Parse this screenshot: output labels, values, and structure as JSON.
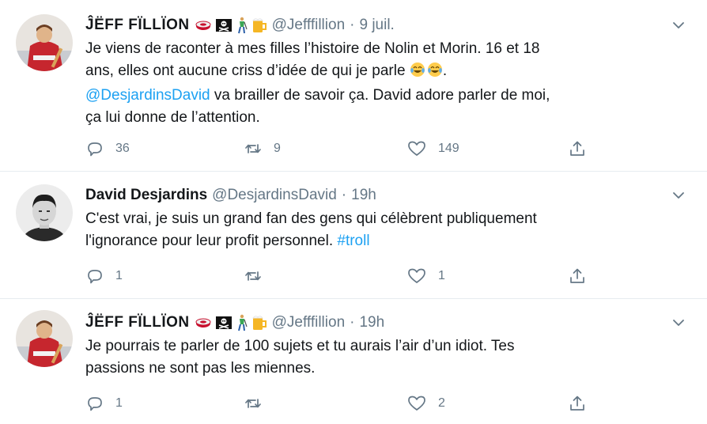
{
  "tweets": [
    {
      "name": "ĴËFF FÏLLÏON",
      "handle": "@Jefffillion",
      "sep": "·",
      "time": "9 juil.",
      "line1": "Je viens de raconter à mes filles l’histoire de Nolin et Morin. 16 et 18",
      "line2": "ans, elles ont aucune criss d’idée de qui je parle ",
      "line2_end": ".",
      "mention": "@DesjardinsDavid",
      "line3_rest": " va brailler de savoir ça.  David adore parler de moi,",
      "line4": "ça lui donne de l’attention.",
      "replies": "36",
      "retweets": "9",
      "likes": "149",
      "emoji_names": [
        "hockey-puck-icon",
        "pirate-flag-icon",
        "golfer-icon",
        "beer-mug-icon"
      ]
    },
    {
      "name": "David Desjardins",
      "handle": "@DesjardinsDavid",
      "sep": "·",
      "time": "19h",
      "line1": "C'est vrai, je suis un grand fan des gens qui célèbrent publiquement",
      "line2": "l'ignorance pour leur profit personnel. ",
      "hashtag": "#troll",
      "replies": "1",
      "retweets": "",
      "likes": "1"
    },
    {
      "name": "ĴËFF FÏLLÏON",
      "handle": "@Jefffillion",
      "sep": "·",
      "time": "19h",
      "line1": "Je pourrais te parler de 100 sujets et tu aurais l’air d’un idiot. Tes",
      "line2": "passions ne sont pas les miennes.",
      "replies": "1",
      "retweets": "",
      "likes": "2"
    }
  ],
  "colors": {
    "text": "#14171a",
    "muted": "#657786",
    "link": "#1da1f2",
    "divider": "#e6ecf0"
  }
}
